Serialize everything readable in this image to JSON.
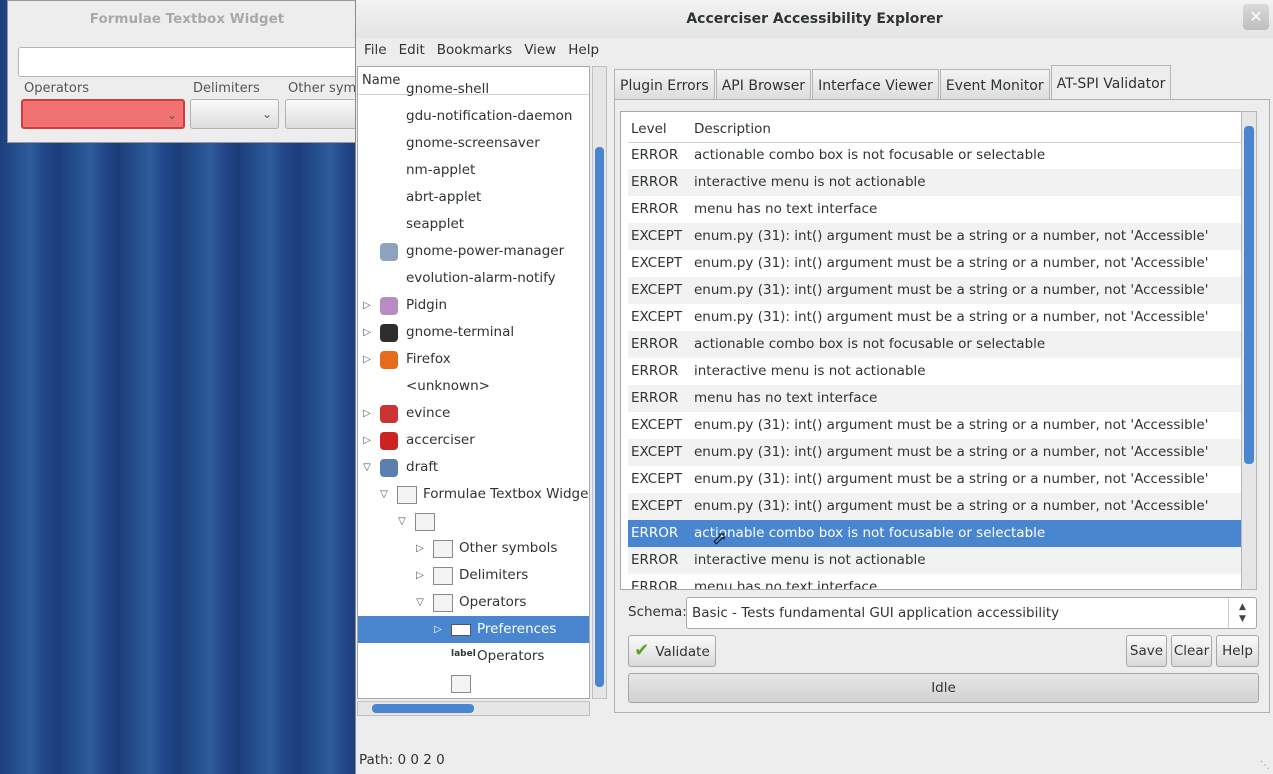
{
  "background_window": {
    "title": "Formulae Textbox Widget",
    "labels": [
      "Operators",
      "Delimiters",
      "Other sym"
    ]
  },
  "window": {
    "title": "Accerciser Accessibility Explorer"
  },
  "menu": [
    "File",
    "Edit",
    "Bookmarks",
    "View",
    "Help"
  ],
  "tree": {
    "header": "Name",
    "rows": [
      {
        "label": "gnome-shell",
        "level": 1
      },
      {
        "label": "gdu-notification-daemon",
        "level": 1
      },
      {
        "label": "gnome-screensaver",
        "level": 1
      },
      {
        "label": "nm-applet",
        "level": 1
      },
      {
        "label": "abrt-applet",
        "level": 1
      },
      {
        "label": "seapplet",
        "level": 1
      },
      {
        "label": "gnome-power-manager",
        "level": 1,
        "icon": "power-manager-icon"
      },
      {
        "label": "evolution-alarm-notify",
        "level": 1
      },
      {
        "label": "Pidgin",
        "level": 1,
        "icon": "pidgin-icon",
        "expander": "collapsed"
      },
      {
        "label": "gnome-terminal",
        "level": 1,
        "icon": "terminal-icon",
        "expander": "collapsed"
      },
      {
        "label": "Firefox",
        "level": 1,
        "icon": "firefox-icon",
        "expander": "collapsed"
      },
      {
        "label": "<unknown>",
        "level": 1
      },
      {
        "label": "evince",
        "level": 1,
        "icon": "evince-icon",
        "expander": "collapsed"
      },
      {
        "label": "accerciser",
        "level": 1,
        "icon": "accerciser-icon",
        "expander": "collapsed"
      },
      {
        "label": "draft",
        "level": 1,
        "icon": "window-icon",
        "expander": "expanded"
      },
      {
        "label": "Formulae Textbox Widge",
        "level": 2,
        "icon": "frame-icon",
        "expander": "expanded"
      },
      {
        "label": "",
        "level": 3,
        "icon": "panel-icon",
        "expander": "expanded"
      },
      {
        "label": "Other symbols",
        "level": 4,
        "icon": "panel-icon",
        "expander": "collapsed"
      },
      {
        "label": "Delimiters",
        "level": 4,
        "icon": "panel-icon",
        "expander": "collapsed"
      },
      {
        "label": "Operators",
        "level": 4,
        "icon": "panel-icon",
        "expander": "expanded"
      },
      {
        "label": "Preferences",
        "level": 5,
        "icon": "combo-box-icon",
        "expander": "collapsed",
        "selected": true
      },
      {
        "label": "Operators",
        "level": 5,
        "icon": "label-icon",
        "icon_text": "label"
      },
      {
        "label": "",
        "level": 5,
        "icon": "text-icon"
      }
    ]
  },
  "tabs": [
    "Plugin Errors",
    "API Browser",
    "Interface Viewer",
    "Event Monitor",
    "AT-SPI Validator"
  ],
  "active_tab": 4,
  "validator": {
    "columns": [
      "Level",
      "Description"
    ],
    "rows": [
      {
        "level": "ERROR",
        "desc": "actionable combo box is not focusable or selectable"
      },
      {
        "level": "ERROR",
        "desc": "interactive menu is not actionable"
      },
      {
        "level": "ERROR",
        "desc": "menu has no text interface"
      },
      {
        "level": "EXCEPT",
        "desc": "enum.py (31): int() argument must be a string or a number, not 'Accessible'"
      },
      {
        "level": "EXCEPT",
        "desc": "enum.py (31): int() argument must be a string or a number, not 'Accessible'"
      },
      {
        "level": "EXCEPT",
        "desc": "enum.py (31): int() argument must be a string or a number, not 'Accessible'"
      },
      {
        "level": "EXCEPT",
        "desc": "enum.py (31): int() argument must be a string or a number, not 'Accessible'"
      },
      {
        "level": "ERROR",
        "desc": "actionable combo box is not focusable or selectable"
      },
      {
        "level": "ERROR",
        "desc": "interactive menu is not actionable"
      },
      {
        "level": "ERROR",
        "desc": "menu has no text interface"
      },
      {
        "level": "EXCEPT",
        "desc": "enum.py (31): int() argument must be a string or a number, not 'Accessible'"
      },
      {
        "level": "EXCEPT",
        "desc": "enum.py (31): int() argument must be a string or a number, not 'Accessible'"
      },
      {
        "level": "EXCEPT",
        "desc": "enum.py (31): int() argument must be a string or a number, not 'Accessible'"
      },
      {
        "level": "EXCEPT",
        "desc": "enum.py (31): int() argument must be a string or a number, not 'Accessible'"
      },
      {
        "level": "ERROR",
        "desc": "actionable combo box is not focusable or selectable",
        "selected": true
      },
      {
        "level": "ERROR",
        "desc": "interactive menu is not actionable"
      },
      {
        "level": "ERROR",
        "desc": "menu has no text interface"
      }
    ],
    "schema_label": "Schema:",
    "schema_value": "Basic - Tests fundamental GUI application accessibility",
    "validate_label": "Validate",
    "save_label": "Save",
    "clear_label": "Clear",
    "help_label": "Help",
    "progress_text": "Idle"
  },
  "status": {
    "path": "Path: 0 0 2 0"
  },
  "colors": {
    "selection": "#4a86cf",
    "error_combo": "#f07272"
  }
}
